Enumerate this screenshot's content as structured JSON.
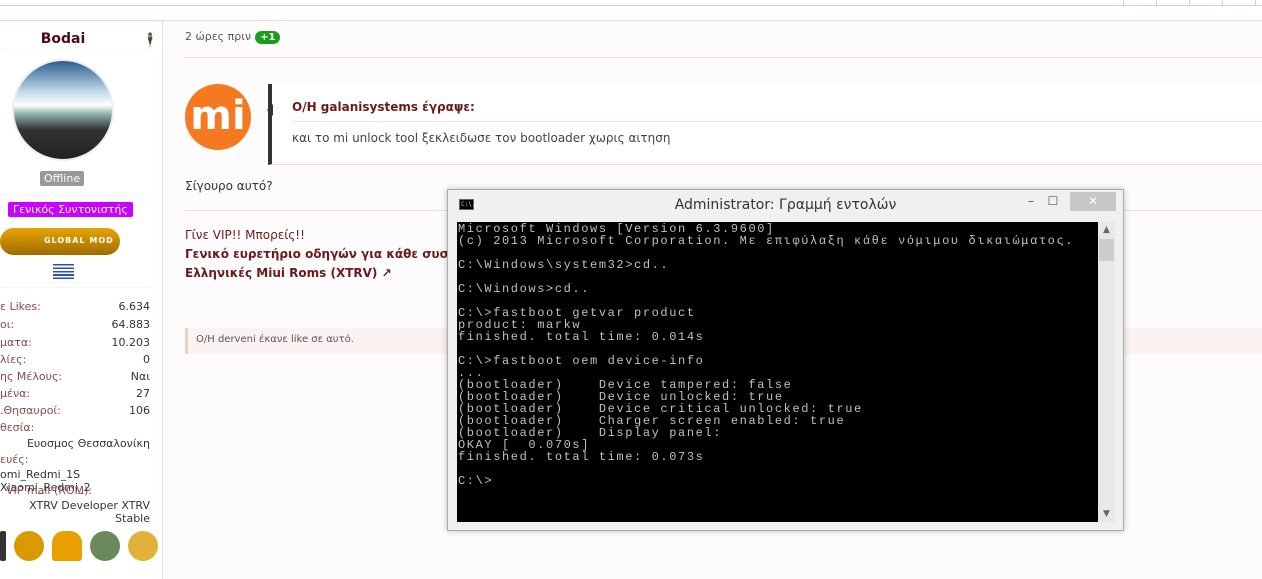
{
  "user": {
    "name": "Bodai",
    "status": "Offline",
    "role": "Γενικός Συντονιστής",
    "rank_badge": "GLOBAL MOD",
    "stats": [
      {
        "k": "ε Likes:",
        "v": "6.634"
      },
      {
        "k": "οι:",
        "v": "64.883"
      },
      {
        "k": "ματα:",
        "v": "10.203"
      },
      {
        "k": "λίες:",
        "v": "0"
      },
      {
        "k": "ης Μέλους:",
        "v": "Ναι"
      },
      {
        "k": "μένα:",
        "v": "27"
      },
      {
        "k": ".Θησαυροί:",
        "v": "106"
      }
    ],
    "location_label": "θεσία:",
    "location": "Ευοσμος Θεσσαλονίκη",
    "devices_label": "ευές:",
    "devices": "omi_Redmi_1S Xiaomi_Redmi_2",
    "vip_label": "VIP mail (ROM):",
    "vip": "XTRV Developer XTRV Stable"
  },
  "post": {
    "time": "2 ώρες πριν",
    "reaction": "+1",
    "logo": "mi",
    "quote_author": "O/H galanisystems έγραψε:",
    "quote_text": "και το mi unlock tool ξεκλειδωσε τον bootloader χωρις αιτηση",
    "body": "Σίγουρο αυτό?",
    "sig": [
      "Γίνε VIP!! Μπορείς!!",
      "Γενικό ευρετήριο οδηγών για κάθε συσκευ",
      "Ελληνικές Miui Roms (XTRV) ↗"
    ],
    "likes": "O/H derveni έκανε like σε αυτό."
  },
  "cmd": {
    "title": "Administrator: Γραμμή εντολών",
    "icon_text": "C:\\.",
    "lines": [
      "Microsoft Windows [Version 6.3.9600]",
      "(c) 2013 Microsoft Corporation. Με επιφύλαξη κάθε νόμιμου δικαιώματος.",
      "",
      "C:\\Windows\\system32>cd..",
      "",
      "C:\\Windows>cd..",
      "",
      "C:\\>fastboot getvar product",
      "product: markw",
      "finished. total time: 0.014s",
      "",
      "C:\\>fastboot oem device-info",
      "...",
      "(bootloader)    Device tampered: false",
      "(bootloader)    Device unlocked: true",
      "(bootloader)    Device critical unlocked: true",
      "(bootloader)    Charger screen enabled: true",
      "(bootloader)    Display panel:",
      "OKAY [  0.070s]",
      "finished. total time: 0.073s",
      "",
      "C:\\>"
    ]
  }
}
